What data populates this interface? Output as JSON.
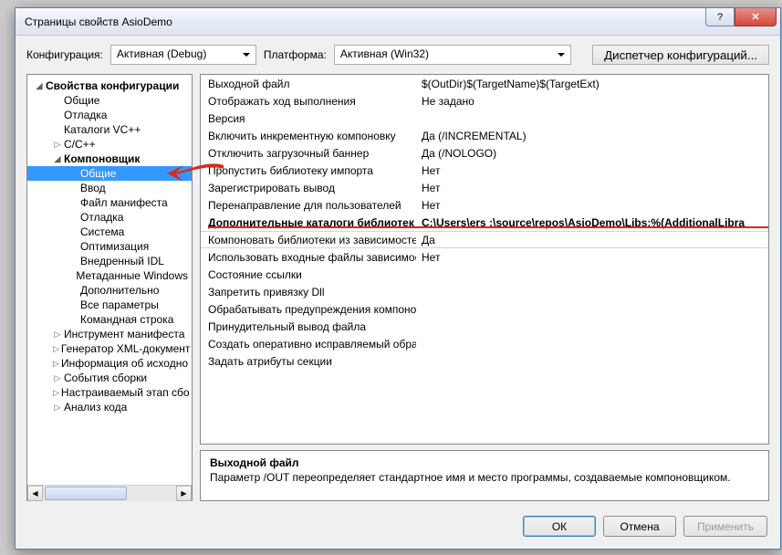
{
  "window": {
    "title": "Страницы свойств AsioDemo"
  },
  "titlebar": {
    "help": "?",
    "close": "✕"
  },
  "config": {
    "cfg_label": "Конфигурация:",
    "cfg_value": "Активная (Debug)",
    "plat_label": "Платформа:",
    "plat_value": "Активная (Win32)",
    "mgr_button": "Диспетчер конфигураций..."
  },
  "tree": [
    {
      "l": 0,
      "c": "open",
      "bold": true,
      "t": "Свойства конфигурации"
    },
    {
      "l": 1,
      "c": "",
      "t": "Общие"
    },
    {
      "l": 1,
      "c": "",
      "t": "Отладка"
    },
    {
      "l": 1,
      "c": "",
      "t": "Каталоги VC++"
    },
    {
      "l": 1,
      "c": "closed",
      "t": "C/C++"
    },
    {
      "l": 1,
      "c": "open",
      "bold": true,
      "t": "Компоновщик"
    },
    {
      "l": 2,
      "c": "",
      "sel": true,
      "t": "Общие"
    },
    {
      "l": 2,
      "c": "",
      "t": "Ввод"
    },
    {
      "l": 2,
      "c": "",
      "t": "Файл манифеста"
    },
    {
      "l": 2,
      "c": "",
      "t": "Отладка"
    },
    {
      "l": 2,
      "c": "",
      "t": "Система"
    },
    {
      "l": 2,
      "c": "",
      "t": "Оптимизация"
    },
    {
      "l": 2,
      "c": "",
      "t": "Внедренный IDL"
    },
    {
      "l": 2,
      "c": "",
      "t": "Метаданные Windows"
    },
    {
      "l": 2,
      "c": "",
      "t": "Дополнительно"
    },
    {
      "l": 2,
      "c": "",
      "t": "Все параметры"
    },
    {
      "l": 2,
      "c": "",
      "t": "Командная строка"
    },
    {
      "l": 1,
      "c": "closed",
      "t": "Инструмент манифеста"
    },
    {
      "l": 1,
      "c": "closed",
      "t": "Генератор XML-документ"
    },
    {
      "l": 1,
      "c": "closed",
      "t": "Информация об исходно"
    },
    {
      "l": 1,
      "c": "closed",
      "t": "События сборки"
    },
    {
      "l": 1,
      "c": "closed",
      "t": "Настраиваемый этап сбо"
    },
    {
      "l": 1,
      "c": "closed",
      "t": "Анализ кода"
    }
  ],
  "grid": [
    {
      "k": "Выходной файл",
      "v": "$(OutDir)$(TargetName)$(TargetExt)"
    },
    {
      "k": "Отображать ход выполнения",
      "v": "Не задано"
    },
    {
      "k": "Версия",
      "v": ""
    },
    {
      "k": "Включить инкрементную компоновку",
      "v": "Да (/INCREMENTAL)"
    },
    {
      "k": "Отключить загрузочный баннер",
      "v": "Да (/NOLOGO)"
    },
    {
      "k": "Пропустить библиотеку импорта",
      "v": "Нет"
    },
    {
      "k": "Зарегистрировать вывод",
      "v": "Нет"
    },
    {
      "k": "Перенаправление для пользователей",
      "v": "Нет"
    },
    {
      "k": "Дополнительные каталоги библиотек",
      "v": "C:\\Users\\ers      :\\source\\repos\\AsioDemo\\Libs;%(AdditionalLibra",
      "bold": true
    },
    {
      "k": "Компоновать библиотеки из зависимосте",
      "v": "Да",
      "cat": true
    },
    {
      "k": "Использовать входные файлы зависимост",
      "v": "Нет"
    },
    {
      "k": "Состояние ссылки",
      "v": ""
    },
    {
      "k": "Запретить привязку Dll",
      "v": ""
    },
    {
      "k": "Обрабатывать предупреждения компонов",
      "v": ""
    },
    {
      "k": "Принудительный вывод файла",
      "v": ""
    },
    {
      "k": "Создать оперативно исправляемый образ",
      "v": ""
    },
    {
      "k": "Задать атрибуты секции",
      "v": ""
    }
  ],
  "desc": {
    "title": "Выходной файл",
    "body": "Параметр /OUT переопределяет стандартное имя и место программы, создаваемые компоновщиком."
  },
  "footer": {
    "ok": "ОК",
    "cancel": "Отмена",
    "apply": "Применить"
  }
}
